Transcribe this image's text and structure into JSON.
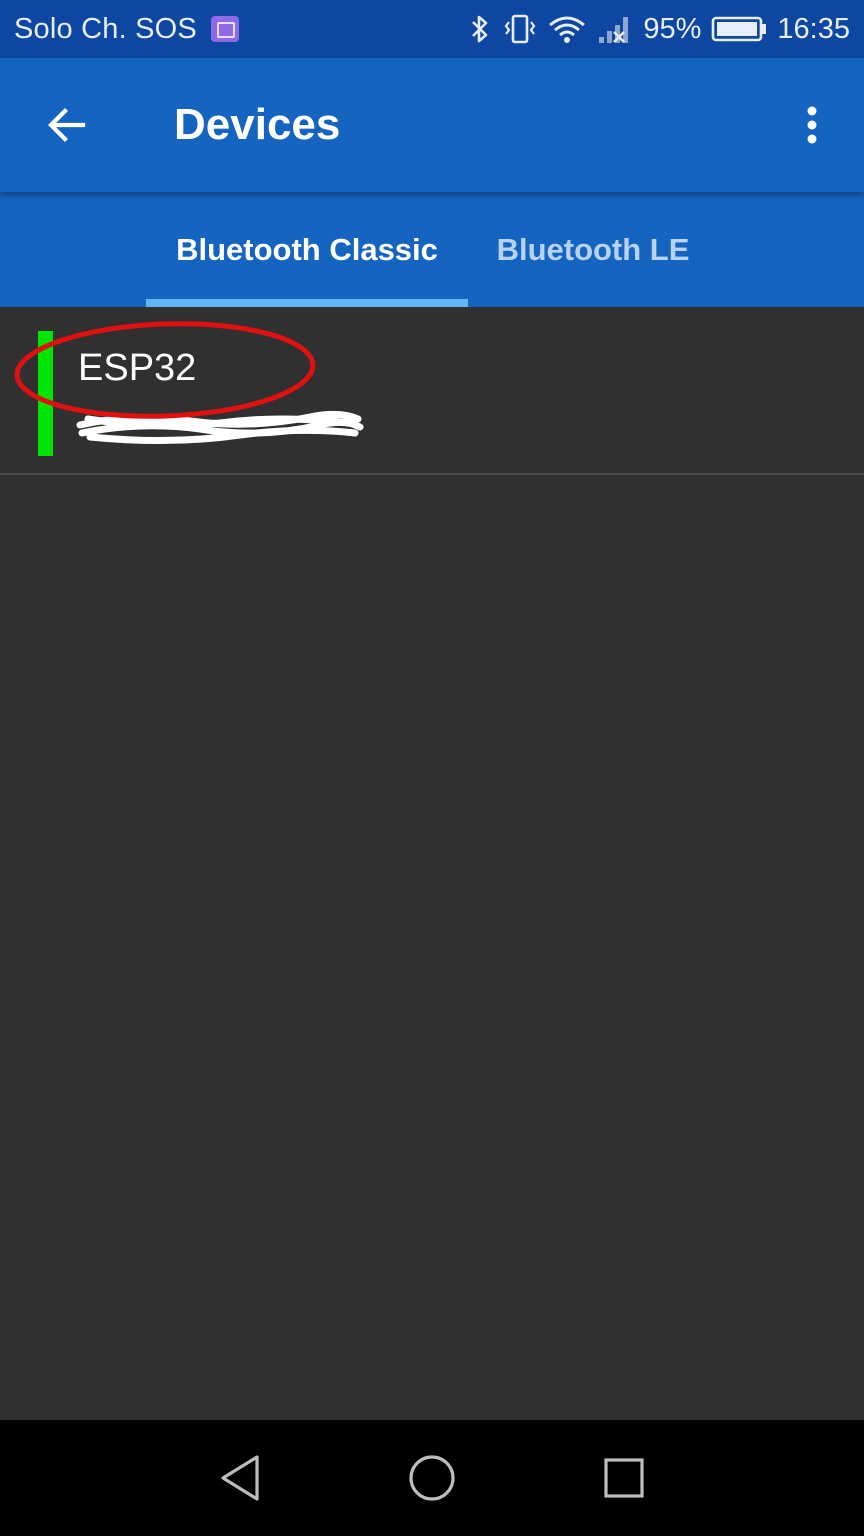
{
  "status_bar": {
    "carrier": "Solo Ch. SOS",
    "battery_percent": "95%",
    "time": "16:35",
    "icons": [
      "gallery-icon",
      "bluetooth-icon",
      "vibrate-icon",
      "wifi-icon",
      "cell-signal-icon",
      "battery-icon"
    ]
  },
  "app_bar": {
    "title": "Devices",
    "back_icon": "arrow-back-icon",
    "menu_icon": "more-vert-icon"
  },
  "tabs": [
    {
      "label": "Bluetooth Classic",
      "selected": true
    },
    {
      "label": "Bluetooth LE",
      "selected": false
    }
  ],
  "devices": [
    {
      "name": "ESP32",
      "address": "",
      "status_color": "#00e400"
    }
  ],
  "annotation": {
    "color": "#e01010"
  },
  "nav_bar": {
    "icons": [
      "nav-back-icon",
      "nav-home-icon",
      "nav-recents-icon"
    ]
  },
  "colors": {
    "status_bar": "#0d47a1",
    "primary": "#1565c0",
    "tab_indicator": "#64b5f6",
    "background": "#303030"
  }
}
